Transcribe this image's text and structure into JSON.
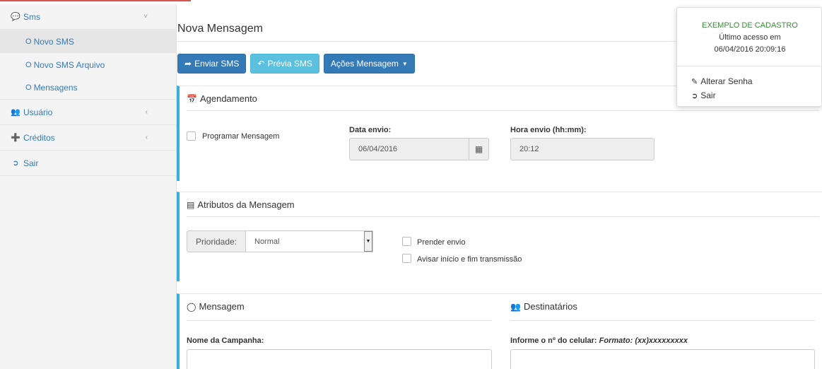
{
  "sidebar": {
    "sms": {
      "label": "Sms",
      "icon": "comments-icon",
      "chevron": "˅"
    },
    "submenu": [
      {
        "label": "Novo SMS",
        "active": true
      },
      {
        "label": "Novo SMS Arquivo",
        "active": false
      },
      {
        "label": "Mensagens",
        "active": false
      }
    ],
    "usuario": {
      "label": "Usuário",
      "chevron": "‹"
    },
    "creditos": {
      "label": "Créditos",
      "chevron": "‹"
    },
    "sair": {
      "label": "Sair"
    }
  },
  "main": {
    "title": "Nova Mensagem",
    "toolbar": {
      "enviar": "Enviar SMS",
      "previa": "Prévia SMS",
      "acoes": "Ações Mensagem"
    },
    "agendamento": {
      "title": "Agendamento",
      "programar_label": "Programar Mensagem",
      "data_label": "Data envio:",
      "data_value": "06/04/2016",
      "hora_label": "Hora envio (hh:mm):",
      "hora_value": "20:12"
    },
    "atributos": {
      "title": "Atributos da Mensagem",
      "prioridade_label": "Prioridade:",
      "prioridade_value": "Normal",
      "prender_label": "Prender envio",
      "avisar_label": "Avisar início e fim transmissão"
    },
    "mensagem": {
      "title": "Mensagem",
      "campanha_label": "Nome da Campanha:",
      "campanha_value": ""
    },
    "destinatarios": {
      "title": "Destinatários",
      "celular_label": "Informe o nº do celular:",
      "celular_format": "Formato: (xx)xxxxxxxxx",
      "celular_value": ""
    }
  },
  "popover": {
    "name": "EXEMPLO DE CADASTRO",
    "last_access_label": "Último acesso em",
    "last_access_value": "06/04/2016 20:09:16",
    "alterar_senha": "Alterar Senha",
    "sair": "Sair"
  },
  "colors": {
    "primary": "#337ab7",
    "info": "#5bc0de",
    "panel_accent": "#3ab1d9",
    "user_name": "#3c8d3c"
  }
}
